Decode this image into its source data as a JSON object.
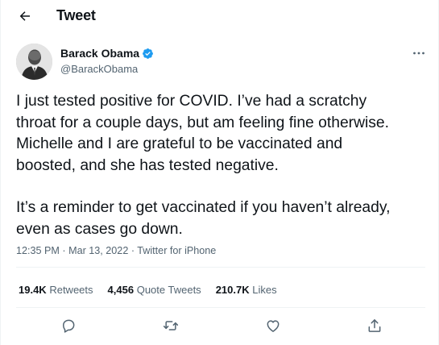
{
  "header": {
    "title": "Tweet",
    "back_icon": "arrow-left-icon"
  },
  "author": {
    "name": "Barack Obama",
    "handle": "@BarackObama",
    "verified_color": "#1d9bf0",
    "more_icon": "more-horizontal-icon"
  },
  "tweet": {
    "lines_para1": [
      "I just tested positive for COVID. I’ve had a scratchy",
      "throat for a couple days, but am feeling fine otherwise.",
      "Michelle and I are grateful to be vaccinated and",
      "boosted, and she has tested negative."
    ],
    "lines_para2": [
      "It’s a reminder to get vaccinated if you haven’t already,",
      "even as cases go down."
    ]
  },
  "meta": {
    "time": "12:35 PM",
    "separator": "·",
    "date": "Mar 13, 2022",
    "source": "Twitter for iPhone"
  },
  "stats": {
    "retweets_count": "19.4K",
    "retweets_label": "Retweets",
    "quotes_count": "4,456",
    "quotes_label": "Quote Tweets",
    "likes_count": "210.7K",
    "likes_label": "Likes"
  },
  "actions": [
    "reply-icon",
    "retweet-icon",
    "like-icon",
    "share-icon"
  ],
  "colors": {
    "text": "#0f1419",
    "secondary": "#536471",
    "divider": "#eff3f4"
  }
}
